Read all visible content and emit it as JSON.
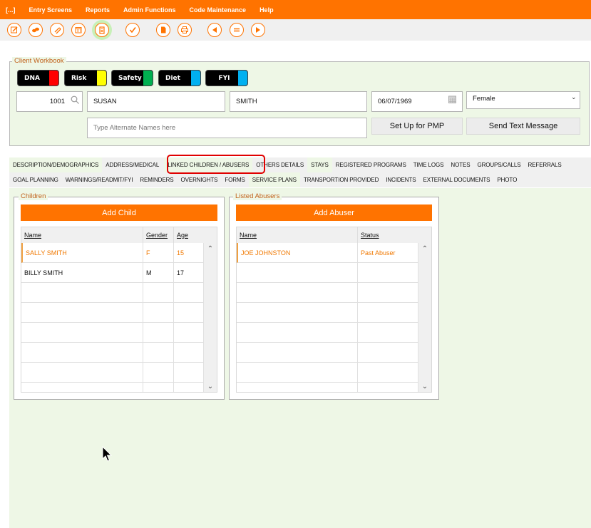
{
  "menu": [
    "[...]",
    "Entry Screens",
    "Reports",
    "Admin Functions",
    "Code Maintenance",
    "Help"
  ],
  "toolbar_icons": [
    "edit-icon",
    "link-icon",
    "attachment-icon",
    "calendar-icon",
    "clipboard-icon",
    "check-icon",
    "document-icon",
    "print-icon",
    "previous-icon",
    "menu-icon",
    "next-icon"
  ],
  "workbook": {
    "legend": "Client Workbook",
    "flags": [
      {
        "label": "DNA",
        "color": "#ff0000"
      },
      {
        "label": "Risk",
        "color": "#ffff00"
      },
      {
        "label": "Safety",
        "color": "#00b050"
      },
      {
        "label": "Diet",
        "color": "#00b0f0"
      },
      {
        "label": "FYI",
        "color": "#00b0f0"
      }
    ],
    "client_id": "1001",
    "first_name": "SUSAN",
    "last_name": "SMITH",
    "dob": "06/07/1969",
    "gender": "Female",
    "alt_names_placeholder": "Type Alternate Names here",
    "pmp_button": "Set Up for PMP",
    "text_button": "Send Text Message"
  },
  "tabs_row1": [
    "DESCRIPTION/DEMOGRAPHICS",
    "ADDRESS/MEDICAL",
    "LINKED CHILDREN / ABUSERS",
    "OTHERS DETAILS",
    "STAYS",
    "REGISTERED PROGRAMS",
    "TIME LOGS",
    "NOTES",
    "GROUPS/CALLS",
    "REFERRALS"
  ],
  "tabs_row2": [
    "GOAL PLANNING",
    "WARNINGS/READMIT/FYI",
    "REMINDERS",
    "OVERNIGHTS",
    "FORMS",
    "SERVICE PLANS",
    "TRANSPORTION PROVIDED",
    "INCIDENTS",
    "EXTERNAL DOCUMENTS",
    "PHOTO"
  ],
  "active_tab": "LINKED CHILDREN / ABUSERS",
  "children": {
    "legend": "Children",
    "add_button": "Add Child",
    "columns": [
      "Name",
      "Gender",
      "Age"
    ],
    "rows": [
      {
        "name": "SALLY SMITH",
        "gender": "F",
        "age": "15"
      },
      {
        "name": "BILLY SMITH",
        "gender": "M",
        "age": "17"
      }
    ]
  },
  "abusers": {
    "legend": "Listed Abusers",
    "add_button": "Add Abuser",
    "columns": [
      "Name",
      "Status"
    ],
    "rows": [
      {
        "name": "JOE JOHNSTON",
        "status": "Past Abuser"
      }
    ]
  },
  "colors": {
    "accent": "#ff7300",
    "panel_bg": "#eef7e6"
  }
}
